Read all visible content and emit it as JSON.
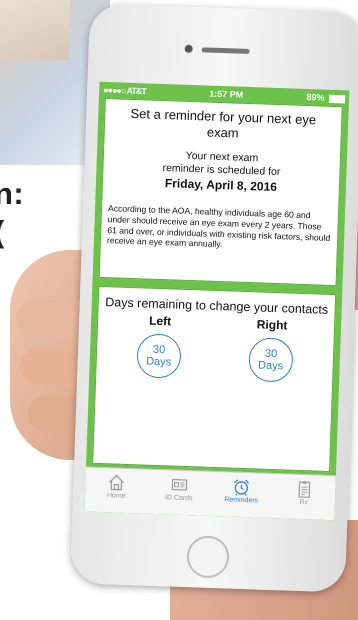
{
  "background": {
    "headline_line1": "n:",
    "headline_line2": "("
  },
  "status_bar": {
    "carrier": "●●●●○ AT&T",
    "time": "1:57 PM",
    "battery": "89%"
  },
  "reminder_card": {
    "title": "Set a reminder for your next eye exam",
    "exam_line1": "Your next exam",
    "exam_line2": "reminder is scheduled for",
    "exam_date": "Friday, April 8, 2016",
    "aoa_text": "According to the AOA, healthy individuals age 60 and under should receive an eye exam every 2 years. Those 61 and over, or individuals with existing risk factors, should receive an eye exam annually."
  },
  "contacts_card": {
    "title": "Days remaining to change your contacts",
    "left_label": "Left",
    "left_days": "30",
    "left_unit": "Days",
    "right_label": "Right",
    "right_days": "30",
    "right_unit": "Days"
  },
  "tabs": [
    {
      "label": "Home",
      "icon": "home-icon"
    },
    {
      "label": "ID Cards",
      "icon": "id-card-icon"
    },
    {
      "label": "Reminders",
      "icon": "alarm-clock-icon"
    },
    {
      "label": "Rx",
      "icon": "clipboard-icon"
    }
  ],
  "colors": {
    "screen_green": "#6cc24a",
    "accent_blue": "#2c7fd3"
  }
}
